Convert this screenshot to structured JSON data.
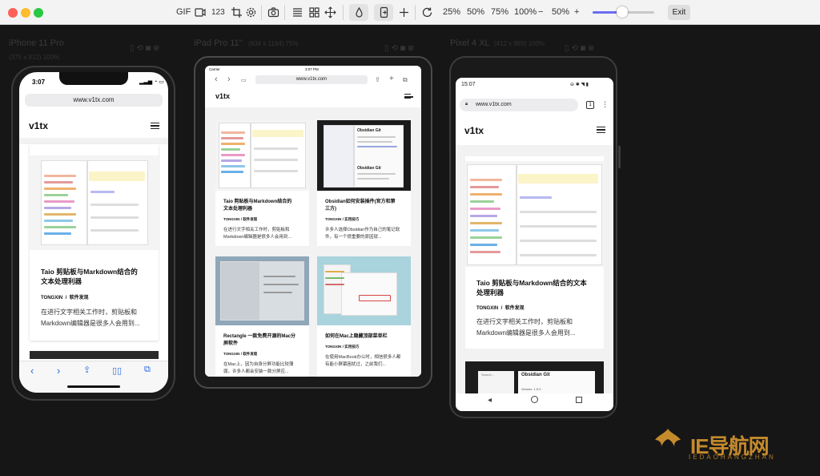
{
  "toolbar": {
    "gif": "GIF",
    "number": "123",
    "zoom_options": [
      "25%",
      "50%",
      "75%",
      "100%"
    ],
    "zoom_minus": "−",
    "zoom_value": "50%",
    "zoom_plus": "+",
    "zoom_level": 0.5,
    "exit": "Exit",
    "colors": {
      "close": "#fe5f57",
      "minimize": "#febc2e",
      "maximize": "#28c840",
      "slider": "#6a6ef0"
    }
  },
  "devices": [
    {
      "name": "iPhone 11 Pro",
      "size": "(375 x 812) 100%"
    },
    {
      "name": "iPad Pro 11\"",
      "size": "(834 x 1194) 75%"
    },
    {
      "name": "Pixel 4 XL",
      "size": "(412 x 869) 100%"
    }
  ],
  "iphone": {
    "time": "3:07",
    "url": "www.v1tx.com",
    "logo": "v1tx",
    "article": {
      "title_line1": "Taio 剪贴板与Markdown结合的",
      "title_line2": "文本处理利器",
      "author": "TONGXIN",
      "sep": "/",
      "category": "软件发现",
      "excerpt_line1": "在进行文字相关工作时，剪贴板和",
      "excerpt_line2": "Markdown编辑器是很多人会用到..."
    }
  },
  "ipad": {
    "status_left": "Carrier",
    "status_time": "3:07 PM",
    "url": "www.v1tx.com",
    "logo": "v1tx",
    "cards": [
      {
        "title_line1": "Taio 剪贴板与Markdown结合的",
        "title_line2": "文本处理利器",
        "author": "TONGXIN",
        "sep": "/",
        "category": "软件发现",
        "excerpt_line1": "在进行文字相关工作时，剪贴板和",
        "excerpt_line2": "Markdown编辑器是很多人会用到..."
      },
      {
        "title_line1": "Obsidian如何安装插件(官方和第",
        "title_line2": "三方)",
        "author": "TONGXIN",
        "sep": "/",
        "category": "实用技巧",
        "excerpt_line1": "许多人选择Obsidian作为自己的笔记软",
        "excerpt_line2": "件，有一个很重要的原因就..."
      },
      {
        "title_line1": "Rectangle 一款免费开源的Mac分",
        "title_line2": "屏软件",
        "author": "TONGXIN",
        "sep": "/",
        "category": "软件发现",
        "excerpt_line1": "在Mac上，因为自身分屏功能比较薄",
        "excerpt_line2": "弱，许多人都会安装一款分屏应..."
      },
      {
        "title_line1": "如何在Mac上隐藏顶部菜单栏",
        "title_line2": "",
        "author": "TONGXIN",
        "sep": "/",
        "category": "实用技巧",
        "excerpt_line1": "在使用MacBook办公时，相信很多人都",
        "excerpt_line2": "有能小屏幕困扰过，之前我们..."
      }
    ],
    "obsidian": {
      "title": "Obsidian Git",
      "title2": "Obsidian Git"
    }
  },
  "pixel": {
    "time": "15:07",
    "url": "www.v1tx.com",
    "tabs": "1",
    "logo": "v1tx",
    "article": {
      "title_line1": "Taio 剪贴板与Markdown结合的文本",
      "title_line2": "处理利器",
      "author": "TONGXIN",
      "sep": "/",
      "category": "软件发现",
      "excerpt_line1": "在进行文字相关工作时，剪贴板和",
      "excerpt_line2": "Markdown编辑器是很多人会用到..."
    },
    "next_title": "Obsidian Git",
    "next_search": "Search...",
    "next_ver": "Version: 1.5.0"
  },
  "watermark": {
    "title": "IE导航网",
    "subtitle": "IEDAOHANGZHAN"
  }
}
